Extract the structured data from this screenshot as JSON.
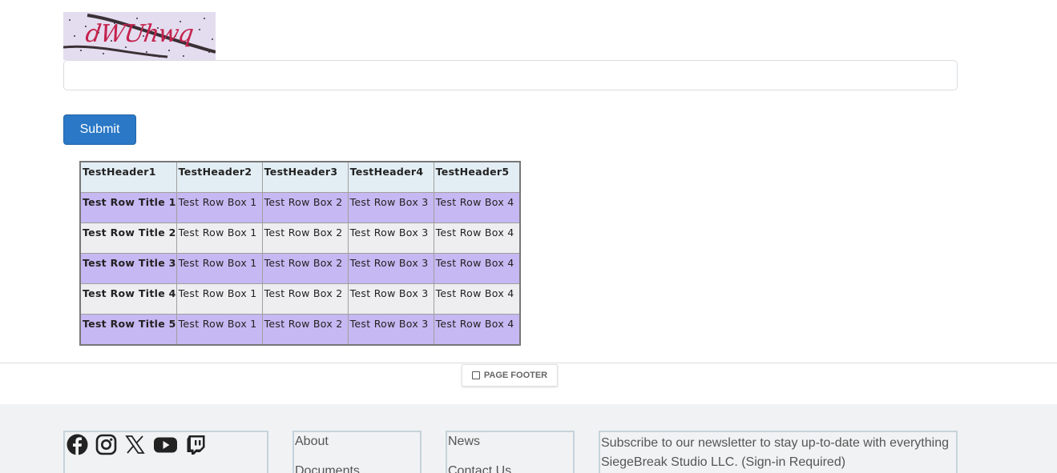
{
  "captcha": {
    "text": "dWUhwq",
    "input_value": "",
    "accent_color": "#c4224c"
  },
  "form": {
    "submit_label": "Submit",
    "button_color": "#2a78c6"
  },
  "table": {
    "headers": [
      "TestHeader1",
      "TestHeader2",
      "TestHeader3",
      "TestHeader4",
      "TestHeader5"
    ],
    "rows": [
      [
        "Test Row Title 1",
        "Test Row Box 1",
        "Test Row Box 2",
        "Test Row Box 3",
        "Test Row Box 4"
      ],
      [
        "Test Row Title 2",
        "Test Row Box 1",
        "Test Row Box 2",
        "Test Row Box 3",
        "Test Row Box 4"
      ],
      [
        "Test Row Title 3",
        "Test Row Box 1",
        "Test Row Box 2",
        "Test Row Box 3",
        "Test Row Box 4"
      ],
      [
        "Test Row Title 4",
        "Test Row Box 1",
        "Test Row Box 2",
        "Test Row Box 3",
        "Test Row Box 4"
      ],
      [
        "Test Row Title 5",
        "Test Row Box 1",
        "Test Row Box 2",
        "Test Row Box 3",
        "Test Row Box 4"
      ]
    ],
    "header_color": "#e3eef4",
    "odd_row_color": "#c6b8f2",
    "even_row_color": "#eeeef0"
  },
  "page_footer": {
    "tag_label": "PAGE FOOTER"
  },
  "footer": {
    "social_icons": [
      "facebook-icon",
      "instagram-icon",
      "x-twitter-icon",
      "youtube-icon",
      "twitch-icon"
    ],
    "links_col1": [
      "About",
      "Documents"
    ],
    "links_col2": [
      "News",
      "Contact Us"
    ],
    "newsletter_text": "Subscribe to our newsletter to stay up-to-date with everything SiegeBreak Studio LLC. (Sign-in Required)",
    "background_color": "#f1f2f3"
  }
}
